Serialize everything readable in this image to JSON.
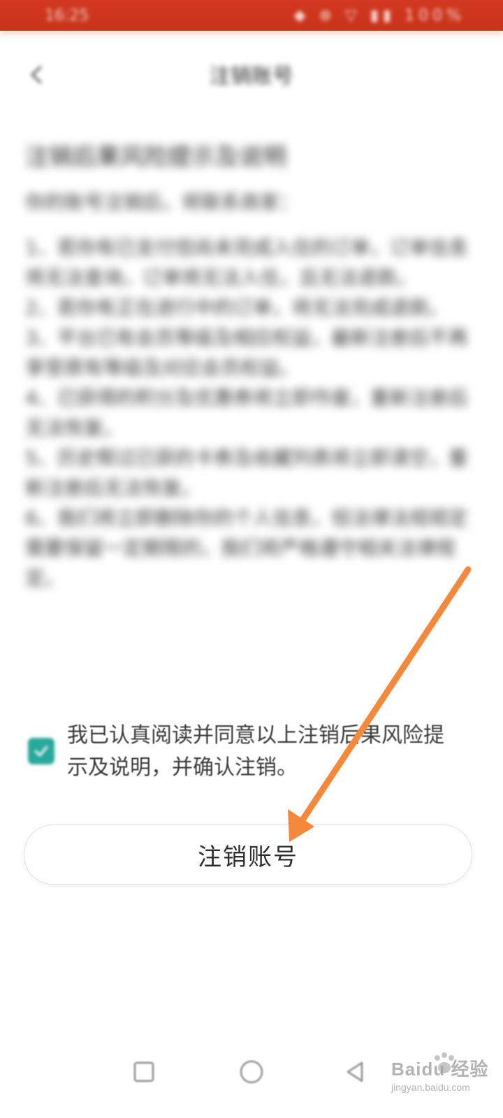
{
  "status_bar": {
    "time": "16:25",
    "icons_text": "◆ ⊗ ▽ ▮▮ 100%",
    "background": "#d2381f"
  },
  "header": {
    "title": "注销账号",
    "back_icon": "back-arrow-icon"
  },
  "content": {
    "heading": "注销后果风险提示及说明",
    "intro": "你的账号注销后，将联系商家：",
    "paragraphs": [
      "1、若你有已支付但尚未完成入住的订单，订单信息将无法查询，订单将无法入住，且无法退款。",
      "2、若你有正在进行中的订单，将无法完成退款。",
      "3、平台已有会员等级及相应权益，最新注册后不再享受原有等级及对应会员权益。",
      "4、已获得的积分及优惠券将立即作废，重新注册后无法恢复。",
      "5、历史帮过已获的卡券及收藏列表将立即清空，重新注册后无法恢复。",
      "6、我们将立即删除你的个人信息，但法律法规规定需要保留一定期限的，我们将严格遵守相关法律规定。"
    ]
  },
  "agreement": {
    "checked": true,
    "text": "我已认真阅读并同意以上注销后果风险提示及说明，并确认注销。",
    "checkbox_color": "#2aa79b"
  },
  "actions": {
    "deregister_label": "注销账号"
  },
  "annotation": {
    "arrow_color": "#f5883a"
  },
  "nav": {
    "recent_icon": "square-icon",
    "home_icon": "circle-icon",
    "back_icon": "triangle-back-icon"
  },
  "watermark": {
    "brand": "Baidu 经验",
    "url": "jingyan.baidu.com"
  }
}
